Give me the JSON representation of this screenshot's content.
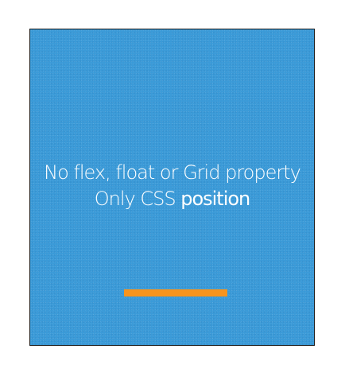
{
  "card": {
    "line1": "No flex, float or Grid property",
    "line2_prefix": "Only CSS ",
    "line2_emphasis": "position"
  },
  "colors": {
    "background": "#3a9ad8",
    "text": "#ffffff",
    "accent_bar": "#f7941d",
    "border": "#1a1a1a"
  }
}
